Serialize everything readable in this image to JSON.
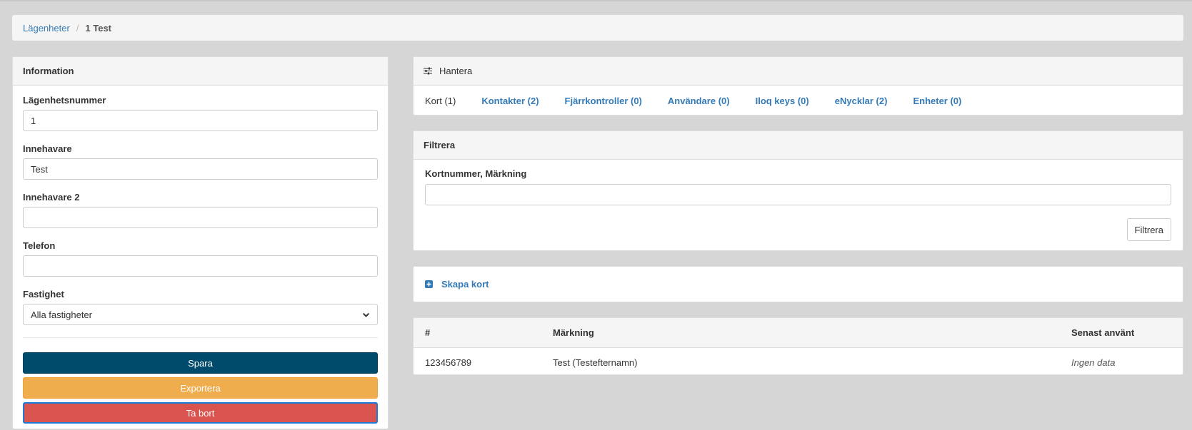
{
  "breadcrumb": {
    "parent": "Lägenheter",
    "separator": "/",
    "current": "1 Test"
  },
  "information": {
    "title": "Information",
    "fields": {
      "apartment_number": {
        "label": "Lägenhetsnummer",
        "value": "1"
      },
      "owner": {
        "label": "Innehavare",
        "value": "Test"
      },
      "owner2": {
        "label": "Innehavare 2",
        "value": ""
      },
      "phone": {
        "label": "Telefon",
        "value": ""
      },
      "property": {
        "label": "Fastighet",
        "value": "Alla fastigheter"
      }
    },
    "buttons": {
      "save": "Spara",
      "export": "Exportera",
      "delete": "Ta bort"
    }
  },
  "manage": {
    "title": "Hantera",
    "tabs": [
      "Kort (1)",
      "Kontakter (2)",
      "Fjärrkontroller (0)",
      "Användare (0)",
      "Iloq keys (0)",
      "eNycklar (2)",
      "Enheter (0)"
    ]
  },
  "filter": {
    "title": "Filtrera",
    "field_label": "Kortnummer, Märkning",
    "field_value": "",
    "button": "Filtrera"
  },
  "create": {
    "label": "Skapa kort"
  },
  "table": {
    "headers": [
      "#",
      "Märkning",
      "Senast använt"
    ],
    "rows": [
      [
        "123456789",
        "Test (Testefternamn)",
        "Ingen data"
      ]
    ]
  },
  "colors": {
    "link": "#337ab7",
    "primary": "#004a6b",
    "warning": "#f0ad4e",
    "danger": "#d9534f"
  },
  "icons": {
    "manage": "sliders-icon",
    "create": "plus-square-icon",
    "select": "chevron-down-icon"
  }
}
